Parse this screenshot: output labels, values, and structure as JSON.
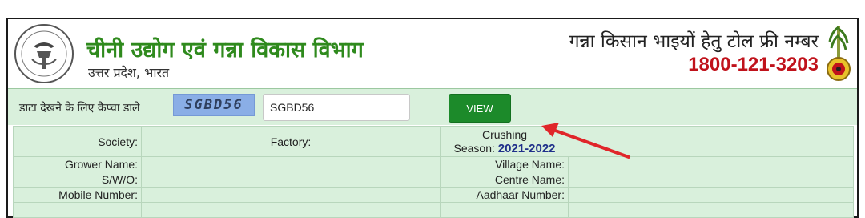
{
  "header": {
    "dept_title": "चीनी उद्योग एवं गन्ना विकास विभाग",
    "dept_subtitle": "उत्तर प्रदेश, भारत",
    "tollfree_label": "गन्ना किसान भाइयों हेतु टोल फ्री नम्बर",
    "tollfree_number": "1800-121-3203"
  },
  "captcha": {
    "label": "डाटा देखने के लिए कैप्चा डाले",
    "image_text": "SGBD56",
    "input_value": "SGBD56",
    "view_label": "VIEW"
  },
  "info": {
    "society_label": "Society:",
    "factory_label": "Factory:",
    "crushing_label": "Crushing",
    "season_label": "Season:",
    "season_value": "2021-2022",
    "grower_name_label": "Grower Name:",
    "village_name_label": "Village Name:",
    "swo_label": "S/W/O:",
    "centre_name_label": "Centre Name:",
    "mobile_label": "Mobile Number:",
    "aadhaar_label": "Aadhaar Number:"
  },
  "colors": {
    "title_green": "#2f8a1d",
    "toll_red": "#c0121b",
    "panel_green": "#d9f0dc",
    "button_green": "#1c8a2a",
    "arrow_red": "#e0262a"
  }
}
